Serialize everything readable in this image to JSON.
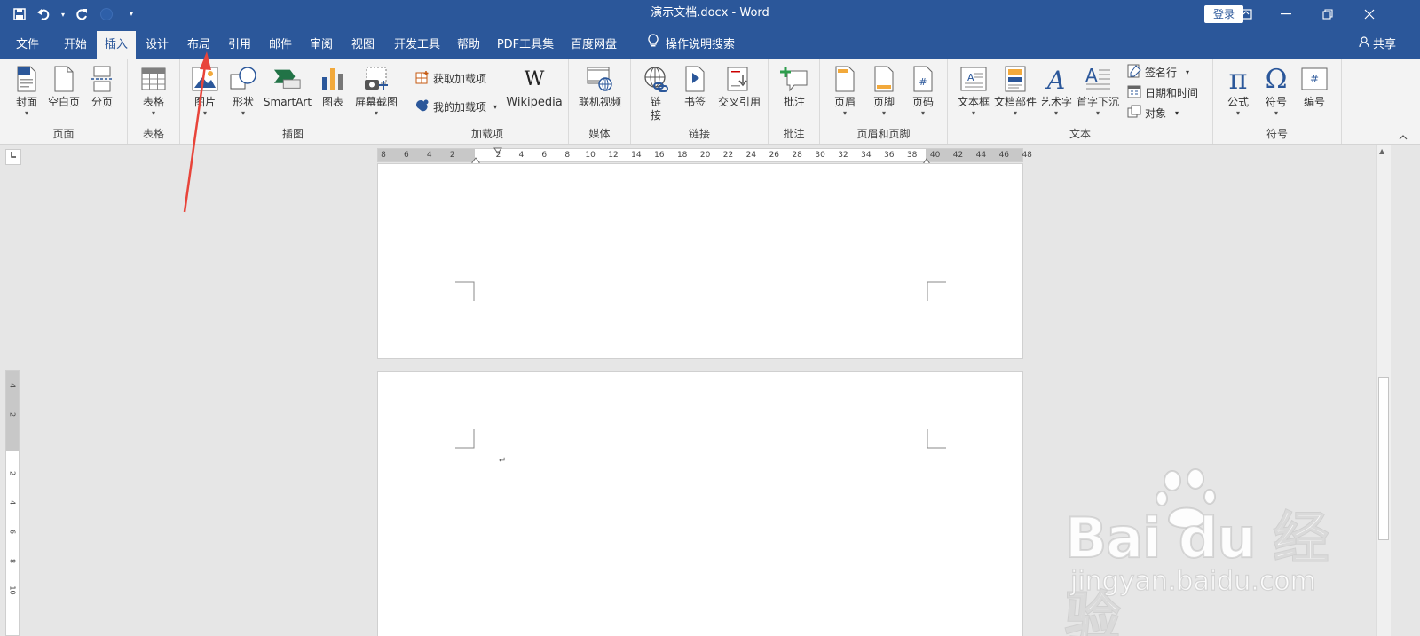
{
  "window": {
    "title": "演示文档.docx  -  Word",
    "login_label": "登录"
  },
  "tabs": [
    {
      "label": "文件"
    },
    {
      "label": "开始"
    },
    {
      "label": "插入"
    },
    {
      "label": "设计"
    },
    {
      "label": "布局"
    },
    {
      "label": "引用"
    },
    {
      "label": "邮件"
    },
    {
      "label": "审阅"
    },
    {
      "label": "视图"
    },
    {
      "label": "开发工具"
    },
    {
      "label": "帮助"
    },
    {
      "label": "PDF工具集"
    },
    {
      "label": "百度网盘"
    }
  ],
  "tell_me": "操作说明搜索",
  "share": "共享",
  "ribbon": {
    "page_group": {
      "label": "页面",
      "cover": "封面",
      "blank": "空白页",
      "break": "分页"
    },
    "table_group": {
      "label": "表格",
      "table": "表格"
    },
    "illustrations_group": {
      "label": "插图",
      "picture": "图片",
      "shapes": "形状",
      "smartart": "SmartArt",
      "chart": "图表",
      "screenshot": "屏幕截图"
    },
    "addins_group": {
      "label": "加载项",
      "get": "获取加载项",
      "my": "我的加载项",
      "wikipedia": "Wikipedia"
    },
    "media_group": {
      "label": "媒体",
      "video": "联机视频"
    },
    "links_group": {
      "label": "链接",
      "link_line1": "链",
      "link_line2": "接",
      "bookmark": "书签",
      "crossref": "交叉引用"
    },
    "comments_group": {
      "label": "批注",
      "comment": "批注"
    },
    "hf_group": {
      "label": "页眉和页脚",
      "header": "页眉",
      "footer": "页脚",
      "pagenum": "页码"
    },
    "text_group": {
      "label": "文本",
      "textbox": "文本框",
      "quickparts": "文档部件",
      "wordart": "艺术字",
      "dropcap": "首字下沉",
      "signature": "签名行",
      "datetime": "日期和时间",
      "object": "对象"
    },
    "symbols_group": {
      "label": "符号",
      "equation": "公式",
      "symbol": "符号",
      "number": "编号"
    }
  },
  "hruler_numbers": [
    "8",
    "6",
    "4",
    "2",
    "",
    "2",
    "4",
    "6",
    "8",
    "10",
    "12",
    "14",
    "16",
    "18",
    "20",
    "22",
    "24",
    "26",
    "28",
    "30",
    "32",
    "34",
    "36",
    "38",
    "40",
    "42",
    "44",
    "46",
    "48"
  ],
  "vruler_numbers": [
    "4",
    "2",
    "",
    "2",
    "4",
    "6",
    "8",
    "10"
  ],
  "watermark": {
    "brand": "Bai du 经验",
    "url": "jingyan.baidu.com"
  },
  "colors": {
    "accent": "#2b579a",
    "ribbon_bg": "#f3f3f3",
    "workspace": "#e6e6e6",
    "annotation": "#e8443a"
  }
}
